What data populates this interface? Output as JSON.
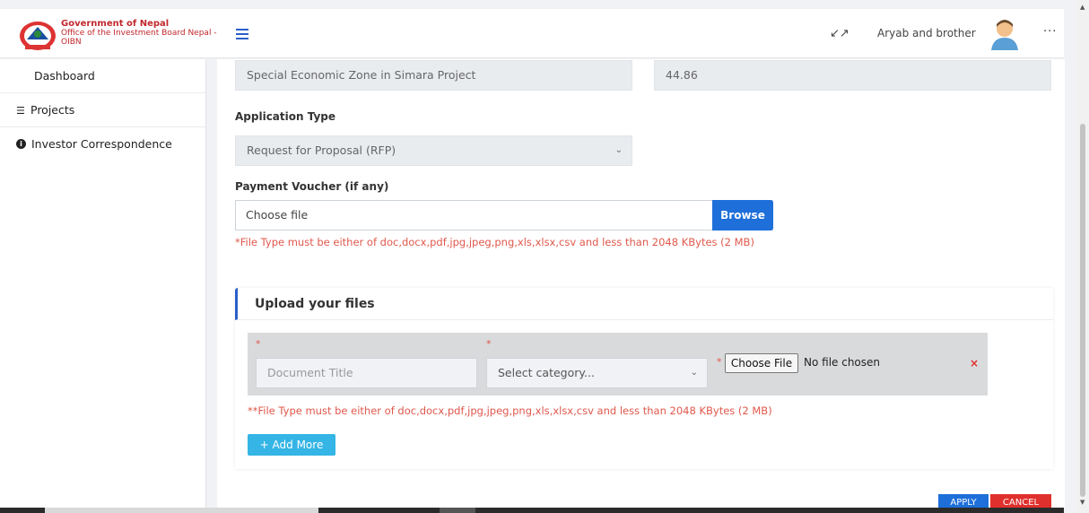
{
  "header": {
    "org_line1": "Government of Nepal",
    "org_line2": "Office of the Investment Board Nepal -",
    "org_line3": "OIBN",
    "user_name": "Aryab and brother",
    "more": "···",
    "expand_icon": "↙↗"
  },
  "sidebar": {
    "items": [
      {
        "label": "Dashboard",
        "icon": ""
      },
      {
        "label": "Projects",
        "icon": "list-icon"
      },
      {
        "label": "Investor Correspondence",
        "icon": "info-icon"
      }
    ]
  },
  "form": {
    "project_name": "Special Economic Zone in Simara Project",
    "project_value": "44.86",
    "application_type_label": "Application Type",
    "application_type_value": "Request for Proposal (RFP)",
    "payment_voucher_label": "Payment Voucher (if any)",
    "choose_file_text": "Choose file",
    "browse_label": "Browse",
    "voucher_error": "*File Type must be either of doc,docx,pdf,jpg,jpeg,png,xls,xlsx,csv and less than 2048 KBytes (2 MB)"
  },
  "upload": {
    "title": "Upload your files",
    "doc_title_placeholder": "Document Title",
    "category_placeholder": "Select category...",
    "choose_file_button": "Choose File",
    "no_file_text": "No file chosen",
    "remove": "×",
    "error": "**File Type must be either of doc,docx,pdf,jpg,jpeg,png,xls,xlsx,csv and less than 2048 KBytes (2 MB)",
    "add_more": "+ Add More",
    "required_star": "*"
  },
  "actions": {
    "apply": "APPLY",
    "cancel": "CANCEL"
  },
  "colors": {
    "accent": "#1e6fd9",
    "danger": "#e0302d",
    "error_text": "#e0584c",
    "add_more": "#34b5e5",
    "brand": "#c0282d"
  }
}
